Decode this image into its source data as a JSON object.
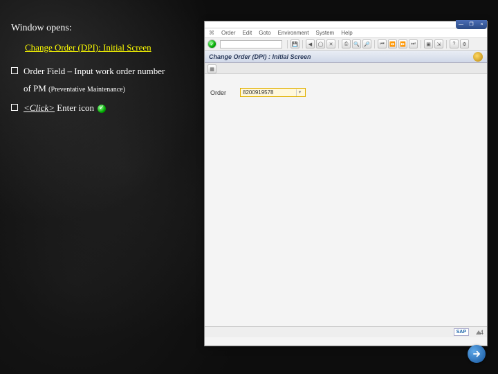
{
  "instructions": {
    "window_opens": "Window opens:",
    "title": "Change Order (DPI):  Initial Screen",
    "line1": "Order Field – Input work order number",
    "line1_sub_prefix": "of  PM ",
    "line1_sub_note": "(Preventative Maintenance)",
    "line2_click": "<Click>",
    "line2_rest": " Enter icon "
  },
  "sap": {
    "menubar": [
      "⌘",
      "Order",
      "Edit",
      "Goto",
      "Environment",
      "System",
      "Help"
    ],
    "win_controls": [
      "—",
      "❐",
      "×"
    ],
    "toolbar_cmd_value": "",
    "screen_title": "Change Order (DPI) :  Initial Screen",
    "order_label": "Order",
    "order_value": "8200919578",
    "logo": "SAP"
  },
  "slide_number": "4"
}
